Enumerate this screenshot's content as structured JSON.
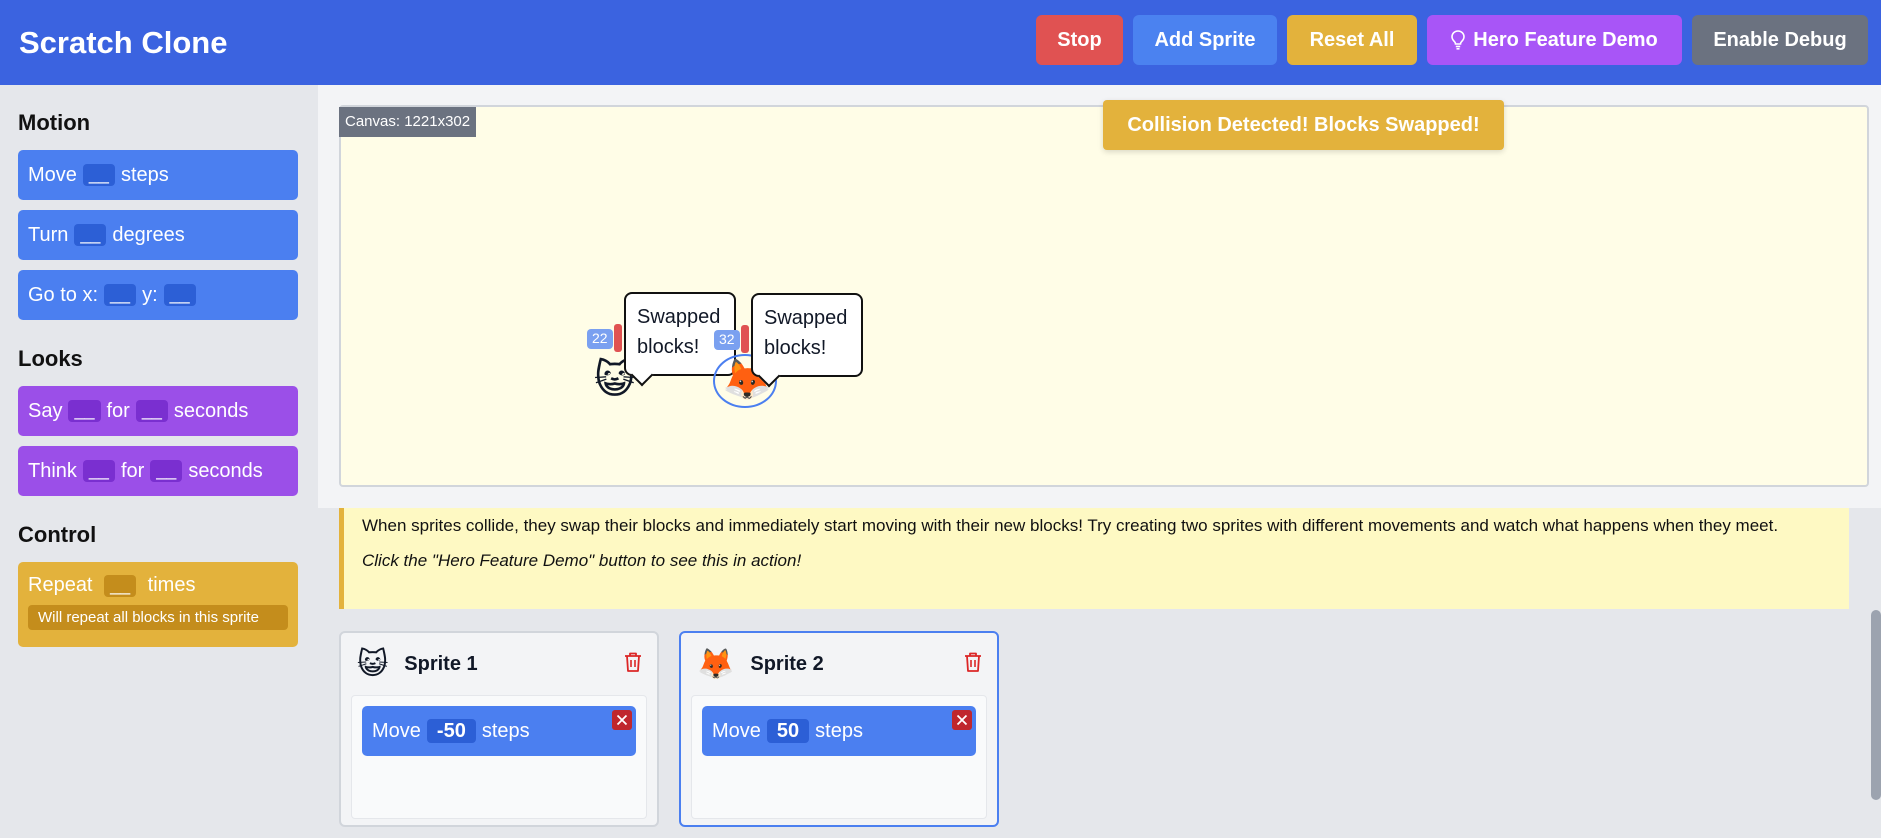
{
  "header": {
    "title": "Scratch Clone",
    "buttons": {
      "stop": "Stop",
      "add_sprite": "Add Sprite",
      "reset_all": "Reset All",
      "hero_demo": "Hero Feature Demo",
      "enable_debug": "Enable Debug"
    }
  },
  "sidebar": {
    "motion": {
      "title": "Motion",
      "move": {
        "pre": "Move",
        "slot": "__",
        "post": "steps"
      },
      "turn": {
        "pre": "Turn",
        "slot": "__",
        "post": "degrees"
      },
      "goto": {
        "pre": "Go to x:",
        "slot1": "__",
        "mid": "y:",
        "slot2": "__"
      }
    },
    "looks": {
      "title": "Looks",
      "say": {
        "pre": "Say",
        "slot1": "__",
        "mid": "for",
        "slot2": "__",
        "post": "seconds"
      },
      "think": {
        "pre": "Think",
        "slot1": "__",
        "mid": "for",
        "slot2": "__",
        "post": "seconds"
      }
    },
    "control": {
      "title": "Control",
      "repeat": {
        "pre": "Repeat",
        "slot": "__",
        "post": "times",
        "note": "Will repeat all blocks in this sprite"
      }
    }
  },
  "stage": {
    "canvas_label": "Canvas: 1221x302",
    "collision_banner": "Collision Detected! Blocks Swapped!",
    "sprite1": {
      "id_label": "22",
      "bubble": "Swapped blocks!",
      "emoji": "😺"
    },
    "sprite2": {
      "id_label": "32",
      "bubble": "Swapped blocks!",
      "emoji": "🦊"
    }
  },
  "info": {
    "text": "When sprites collide, they swap their blocks and immediately start moving with their new blocks! Try creating two sprites with different movements and watch what happens when they meet.",
    "hint": "Click the \"Hero Feature Demo\" button to see this in action!"
  },
  "sprites": [
    {
      "name": "Sprite 1",
      "emoji": "😺",
      "block": {
        "pre": "Move",
        "value": "-50",
        "post": "steps"
      }
    },
    {
      "name": "Sprite 2",
      "emoji": "🦊",
      "block": {
        "pre": "Move",
        "value": "50",
        "post": "steps"
      }
    }
  ],
  "colors": {
    "header": "#3b63e0",
    "motion": "#4b7ff0",
    "looks": "#9b4fe8",
    "control": "#e3b23c",
    "stop": "#e05252",
    "debug": "#6b7280"
  }
}
